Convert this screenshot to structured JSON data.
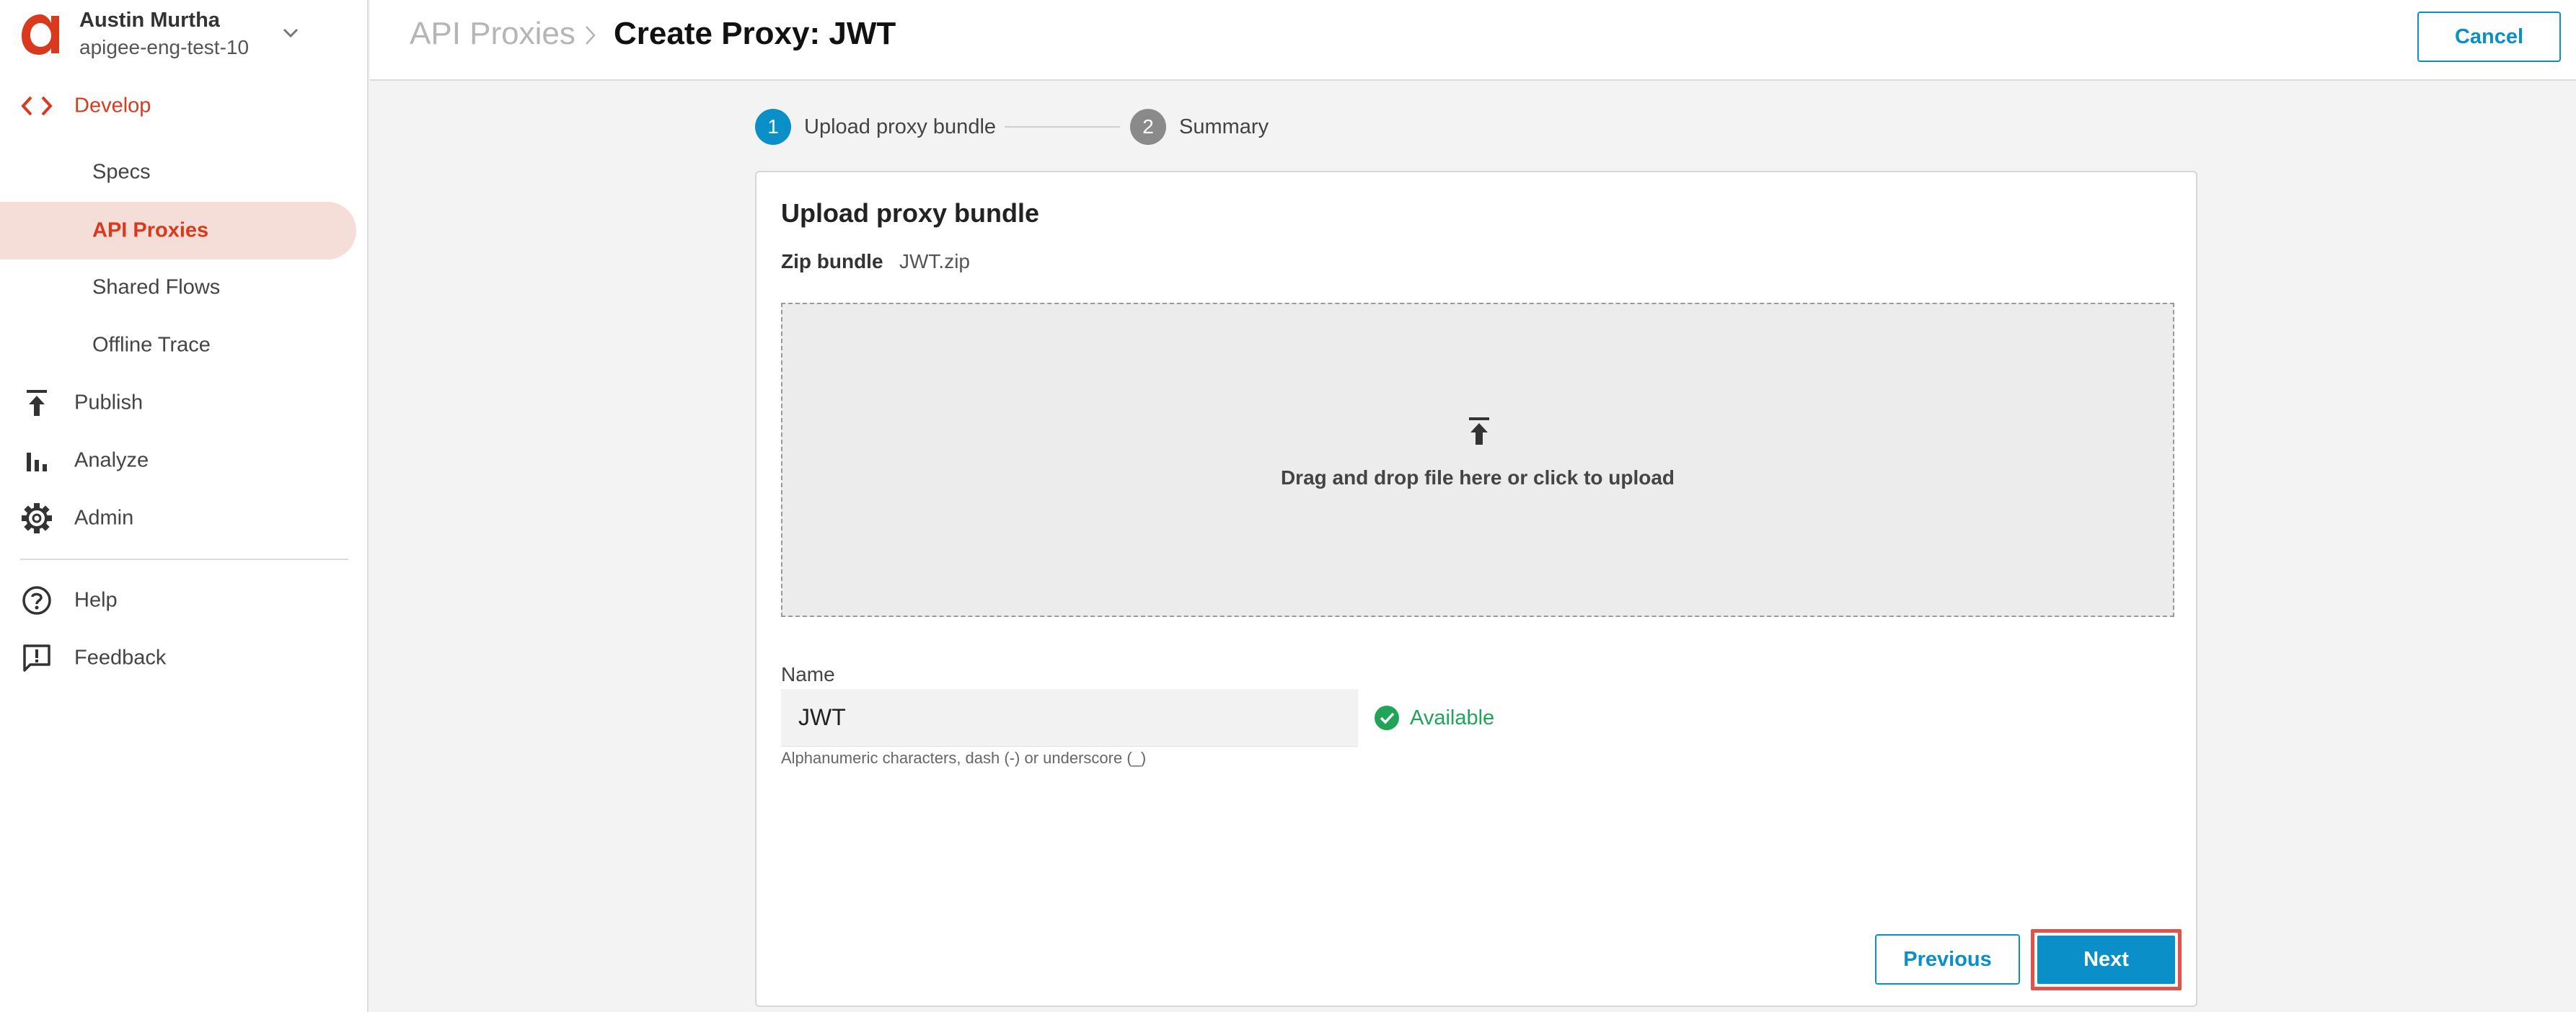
{
  "account": {
    "name": "Austin Murtha",
    "org": "apigee-eng-test-10"
  },
  "sidebar": {
    "items": [
      {
        "label": "Develop",
        "icon": "code-brackets-icon"
      },
      {
        "label": "Specs"
      },
      {
        "label": "API Proxies",
        "active": true
      },
      {
        "label": "Shared Flows"
      },
      {
        "label": "Offline Trace"
      },
      {
        "label": "Publish",
        "icon": "publish-upload-icon"
      },
      {
        "label": "Analyze",
        "icon": "bar-chart-icon"
      },
      {
        "label": "Admin",
        "icon": "gear-icon"
      },
      {
        "label": "Help",
        "icon": "help-circle-icon"
      },
      {
        "label": "Feedback",
        "icon": "feedback-icon"
      }
    ]
  },
  "header": {
    "breadcrumb": "API Proxies",
    "title": "Create Proxy: JWT",
    "cancel_label": "Cancel"
  },
  "stepper": {
    "steps": [
      {
        "number": "1",
        "label": "Upload proxy bundle",
        "active": true
      },
      {
        "number": "2",
        "label": "Summary",
        "active": false
      }
    ]
  },
  "card": {
    "title": "Upload proxy bundle",
    "zip_label": "Zip bundle",
    "zip_value": "JWT.zip",
    "drop_text": "Drag and drop file here or click to upload",
    "name_label": "Name",
    "name_value": "JWT",
    "availability": "Available",
    "hint": "Alphanumeric characters, dash (-) or underscore (_)",
    "previous_label": "Previous",
    "next_label": "Next"
  },
  "colors": {
    "brand": "#d93a1d",
    "primary": "#0b8fc9",
    "success": "#22a35a",
    "highlight": "#e0524a"
  }
}
